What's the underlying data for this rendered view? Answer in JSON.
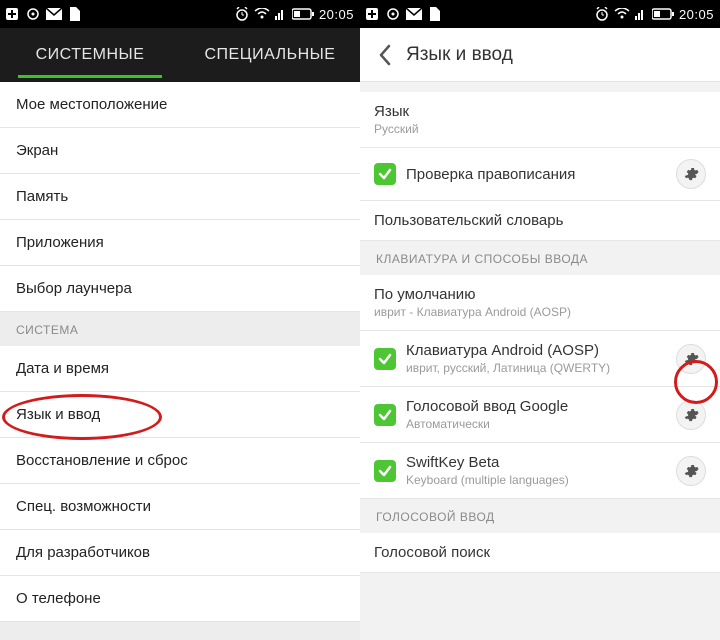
{
  "statusbar": {
    "time": "20:05"
  },
  "left": {
    "tabs": {
      "system": "СИСТЕМНЫЕ",
      "special": "СПЕЦИАЛЬНЫЕ"
    },
    "items_top": [
      "Мое местоположение",
      "Экран",
      "Память",
      "Приложения",
      "Выбор лаунчера"
    ],
    "section_system": "СИСТЕМА",
    "items_system": [
      "Дата и время",
      "Язык и ввод",
      "Восстановление и сброс",
      "Спец. возможности",
      "Для разработчиков",
      "О телефоне"
    ]
  },
  "right": {
    "title": "Язык и ввод",
    "language": {
      "label": "Язык",
      "value": "Русский"
    },
    "spellcheck": "Проверка правописания",
    "user_dict": "Пользовательский словарь",
    "section_kb": "КЛАВИАТУРА И СПОСОБЫ ВВОДА",
    "default": {
      "label": "По умолчанию",
      "value": "иврит - Клавиатура Android (AOSP)"
    },
    "ime": [
      {
        "label": "Клавиатура Android (AOSP)",
        "sub": "иврит, русский, Латиница (QWERTY)"
      },
      {
        "label": "Голосовой ввод Google",
        "sub": "Автоматически"
      },
      {
        "label": "SwiftKey Beta",
        "sub": "Keyboard (multiple languages)"
      }
    ],
    "section_voice": "ГОЛОСОВОЙ ВВОД",
    "voice_search": "Голосовой поиск"
  }
}
